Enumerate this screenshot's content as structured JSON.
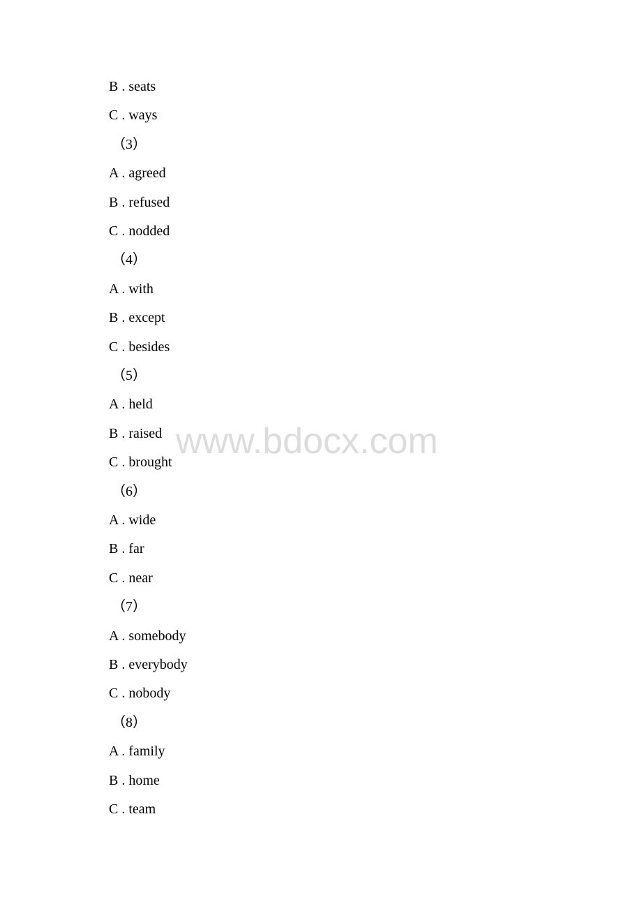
{
  "lines": [
    {
      "type": "option",
      "text": "B . seats"
    },
    {
      "type": "option",
      "text": "C . ways"
    },
    {
      "type": "number",
      "text": "（3）"
    },
    {
      "type": "option",
      "text": "A . agreed"
    },
    {
      "type": "option",
      "text": "B . refused"
    },
    {
      "type": "option",
      "text": "C . nodded"
    },
    {
      "type": "number",
      "text": "（4）"
    },
    {
      "type": "option",
      "text": "A . with"
    },
    {
      "type": "option",
      "text": "B . except"
    },
    {
      "type": "option",
      "text": "C . besides"
    },
    {
      "type": "number",
      "text": "（5）"
    },
    {
      "type": "option",
      "text": "A . held"
    },
    {
      "type": "option",
      "text": "B . raised"
    },
    {
      "type": "option",
      "text": "C . brought"
    },
    {
      "type": "number",
      "text": "（6）"
    },
    {
      "type": "option",
      "text": "A . wide"
    },
    {
      "type": "option",
      "text": "B . far"
    },
    {
      "type": "option",
      "text": "C . near"
    },
    {
      "type": "number",
      "text": "（7）"
    },
    {
      "type": "option",
      "text": "A . somebody"
    },
    {
      "type": "option",
      "text": "B . everybody"
    },
    {
      "type": "option",
      "text": "C . nobody"
    },
    {
      "type": "number",
      "text": "（8）"
    },
    {
      "type": "option",
      "text": "A . family"
    },
    {
      "type": "option",
      "text": "B . home"
    },
    {
      "type": "option",
      "text": "C . team"
    }
  ],
  "watermark": "www.bdocx.com"
}
